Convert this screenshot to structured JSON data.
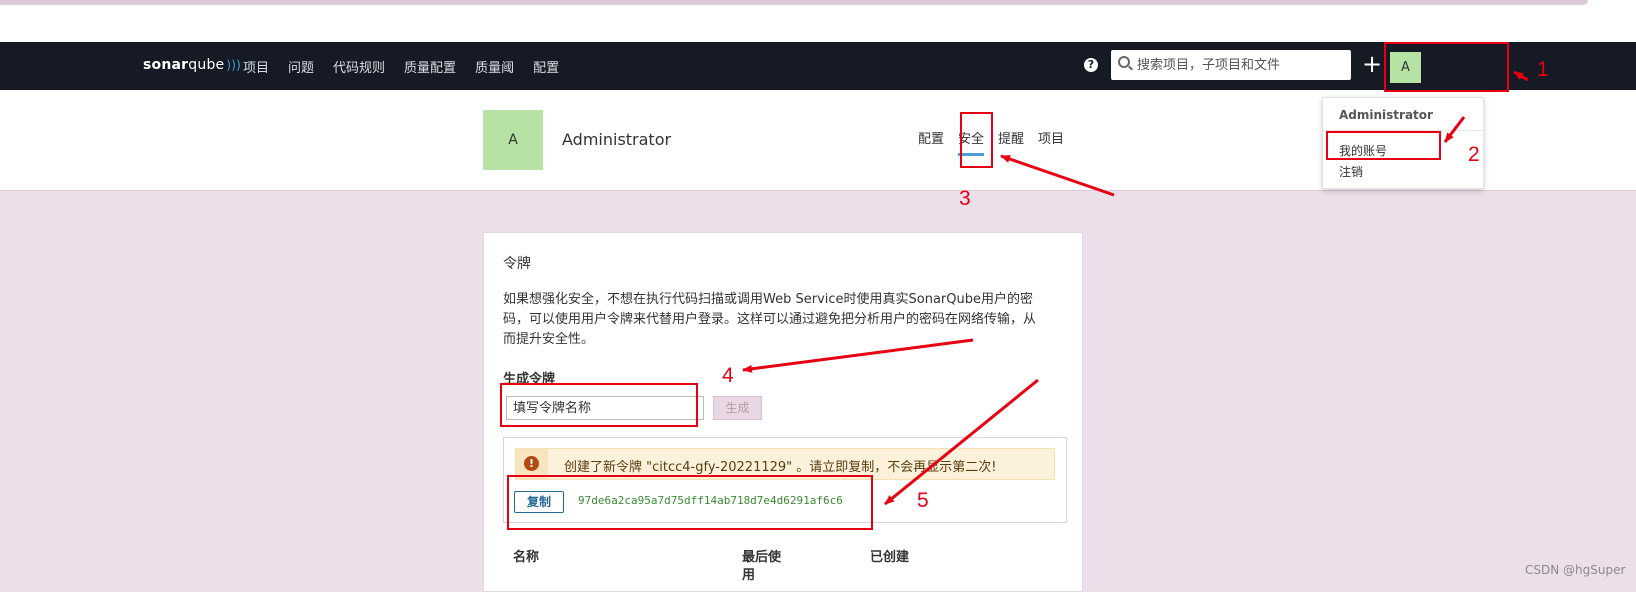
{
  "navbar": {
    "logo_strong": "sonar",
    "logo_rest": "qube",
    "items": [
      "项目",
      "问题",
      "代码规则",
      "质量配置",
      "质量阈",
      "配置"
    ],
    "help_label": "?",
    "search_placeholder": "搜索项目，子项目和文件",
    "plus_label": "+",
    "avatar_letter": "A"
  },
  "profile": {
    "avatar_letter": "A",
    "name": "Administrator",
    "tabs": [
      "配置",
      "安全",
      "提醒",
      "项目"
    ],
    "active_tab": "安全"
  },
  "account_menu": {
    "name": "Administrator",
    "items": [
      "我的账号",
      "注销"
    ]
  },
  "tokens": {
    "title": "令牌",
    "description": "如果想强化安全，不想在执行代码扫描或调用Web Service时使用真实SonarQube用户的密码，可以使用用户令牌来代替用户登录。这样可以通过避免把分析用户的密码在网络传输，从而提升安全性。",
    "generate_title": "生成令牌",
    "name_input_placeholder": "填写令牌名称",
    "generate_button": "生成",
    "warning_icon": "!",
    "warning_message": "创建了新令牌 \"citcc4-gfy-20221129\" 。请立即复制，不会再显示第二次!",
    "copy_button": "复制",
    "token_value": "97de6a2ca95a7d75dff14ab718d7e4d6291af6c6",
    "columns": [
      "名称",
      "最后使用",
      "已创建"
    ]
  },
  "annotations": {
    "numbers": [
      "1",
      "2",
      "3",
      "4",
      "5"
    ],
    "color": "#e60012"
  },
  "watermark": "CSDN @hgSuper"
}
